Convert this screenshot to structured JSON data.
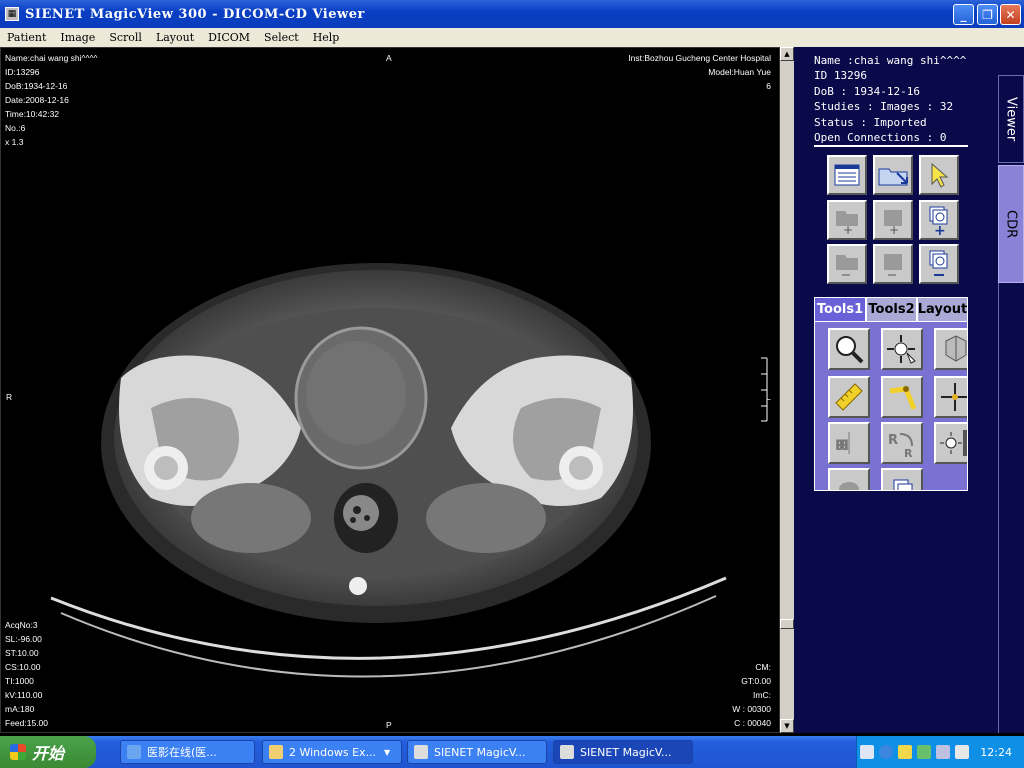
{
  "window": {
    "title": "SIENET MagicView 300  - DICOM-CD Viewer",
    "controls": [
      "minimize",
      "maximize",
      "close"
    ]
  },
  "menu": [
    "Patient",
    "Image",
    "Scroll",
    "Layout",
    "DICOM",
    "Select",
    "Help"
  ],
  "overlay": {
    "top_left": [
      "Name:chai wang shi^^^^",
      "ID:13296",
      "DoB:1934-12-16",
      "Date:2008-12-16",
      "Time:10:42:32",
      "No.:6",
      "x 1.3"
    ],
    "top_center": "A",
    "top_right": [
      "Inst:Bozhou Gucheng Center Hospital",
      "Model:Huan Yue",
      "6"
    ],
    "left_mid": "R",
    "right_mid": "L",
    "bottom_center": "P",
    "bottom_left": [
      "AcqNo:3",
      "SL:-96.00",
      "ST:10.00",
      "CS:10.00",
      "TI:1000",
      "kV:110.00",
      "mA:180",
      "Feed:15.00"
    ],
    "bottom_right": [
      "CM:",
      "GT:0.00",
      "ImC:",
      "W : 00300",
      "C : 00040"
    ]
  },
  "patient_info": {
    "name": "Name :chai wang shi^^^^",
    "id": "ID 13296",
    "dob": "DoB : 1934-12-16",
    "studies": "Studies : Images : 32",
    "status": "Status : Imported",
    "connections": "Open Connections : 0"
  },
  "side_tabs": [
    "Viewer",
    "CDR"
  ],
  "tool_tabs": [
    "Tools1",
    "Tools2",
    "Layout"
  ],
  "toolbar_icons": [
    "worklist-icon",
    "open-folder-icon",
    "pointer-icon",
    "add-folder-icon",
    "add-series-icon",
    "add-image-icon",
    "remove-folder-icon",
    "remove-series-icon",
    "remove-image-icon"
  ],
  "tools1_icons": [
    "magnifier-icon",
    "pan-icon",
    "3d-cube-icon",
    "ruler-icon",
    "angle-icon",
    "crosshair-icon",
    "flip-horizontal-icon",
    "rotate-icon",
    "brightness-icon",
    "ellipse-roi-icon",
    "copy-icon"
  ],
  "taskbar": {
    "start": "开始",
    "tasks": [
      "医影在线(医...",
      "2 Windows Ex...",
      "SIENET MagicV...",
      "SIENET MagicV..."
    ],
    "clock": "12:24"
  },
  "colors": {
    "panel_bg": "#0a0a4a",
    "tools_bg": "#7a72d2",
    "title_blue": "#0a3fc4"
  }
}
